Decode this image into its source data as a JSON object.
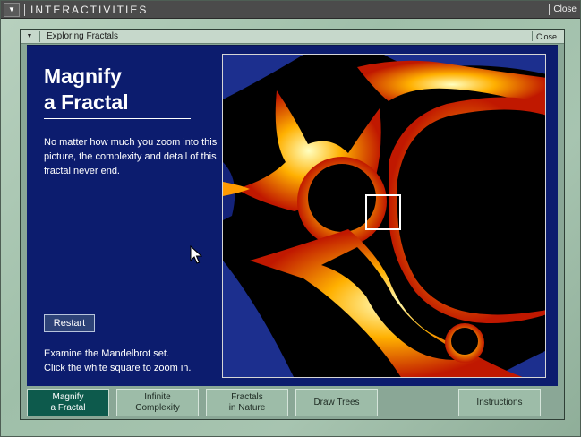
{
  "window": {
    "title": "INTERACTIVITIES",
    "close_label": "Close",
    "menu_icon": "triangle-down-icon"
  },
  "panel": {
    "title": "Exploring Fractals",
    "close_label": "Close",
    "menu_icon": "triangle-down-icon"
  },
  "content": {
    "heading": "Magnify\na Fractal",
    "description": "No matter how much you zoom into this picture, the complexity and detail of this fractal never end.",
    "restart_label": "Restart",
    "instructions": "Examine the Mandelbrot set.\nClick the white square to zoom in."
  },
  "tabs": [
    {
      "label": "Magnify\na Fractal",
      "active": true
    },
    {
      "label": "Infinite\nComplexity",
      "active": false
    },
    {
      "label": "Fractals\nin Nature",
      "active": false
    },
    {
      "label": "Draw Trees",
      "active": false
    },
    {
      "label": "Instructions",
      "active": false
    }
  ],
  "colors": {
    "panel_bg": "#0c1c6e",
    "active_tab": "#0d5a4c",
    "frame": "#9fbfa9"
  }
}
